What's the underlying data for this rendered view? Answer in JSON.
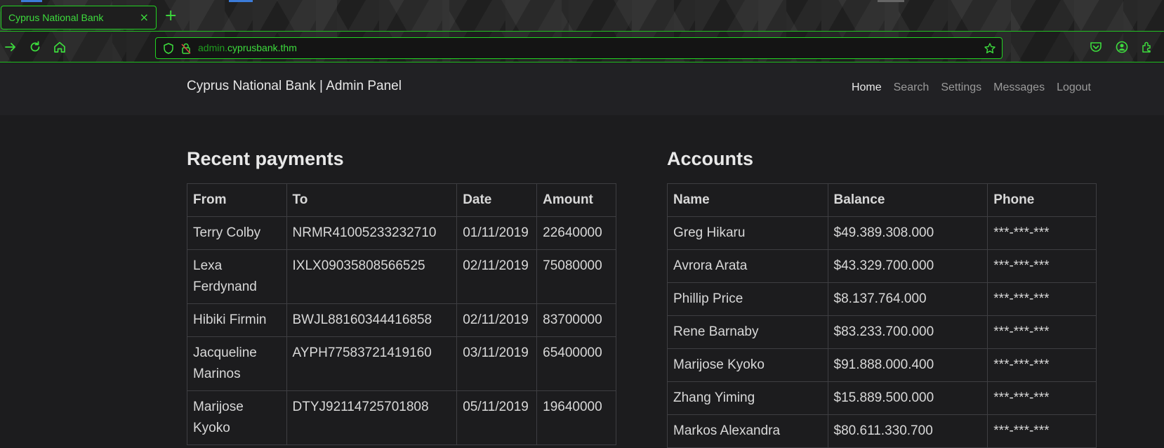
{
  "browser": {
    "tab_title": "Cyprus National Bank",
    "tab_close": "×",
    "new_tab": "+",
    "url_subdomain": "admin.",
    "url_domain": "cyprusbank.thm",
    "accent_color": "#3ddc3d",
    "icons": [
      "forward-icon",
      "reload-icon",
      "home-icon",
      "shield-icon",
      "lock-icon",
      "star-icon",
      "pocket-icon",
      "account-icon",
      "extensions-icon"
    ]
  },
  "header": {
    "brand": "Cyprus National Bank | Admin Panel",
    "menu": [
      {
        "label": "Home",
        "active": true
      },
      {
        "label": "Search",
        "active": false
      },
      {
        "label": "Settings",
        "active": false
      },
      {
        "label": "Messages",
        "active": false
      },
      {
        "label": "Logout",
        "active": false
      }
    ]
  },
  "payments": {
    "title": "Recent payments",
    "columns": [
      "From",
      "To",
      "Date",
      "Amount"
    ],
    "rows": [
      [
        "Terry Colby",
        "NRMR41005233232710",
        "01/11/2019",
        "22640000"
      ],
      [
        "Lexa Ferdynand",
        "IXLX09035808566525",
        "02/11/2019",
        "75080000"
      ],
      [
        "Hibiki Firmin",
        "BWJL88160344416858",
        "02/11/2019",
        "83700000"
      ],
      [
        "Jacqueline Marinos",
        "AYPH77583721419160",
        "03/11/2019",
        "65400000"
      ],
      [
        "Marijose Kyoko",
        "DTYJ92114725701808",
        "05/11/2019",
        "19640000"
      ]
    ]
  },
  "accounts": {
    "title": "Accounts",
    "columns": [
      "Name",
      "Balance",
      "Phone"
    ],
    "rows": [
      [
        "Greg Hikaru",
        "$49.389.308.000",
        "***-***-***"
      ],
      [
        "Avrora Arata",
        "$43.329.700.000",
        "***-***-***"
      ],
      [
        "Phillip Price",
        "$8.137.764.000",
        "***-***-***"
      ],
      [
        "Rene Barnaby",
        "$83.233.700.000",
        "***-***-***"
      ],
      [
        "Marijose Kyoko",
        "$91.888.000.400",
        "***-***-***"
      ],
      [
        "Zhang Yiming",
        "$15.889.500.000",
        "***-***-***"
      ],
      [
        "Markos Alexandra",
        "$80.611.330.700",
        "***-***-***"
      ]
    ]
  }
}
